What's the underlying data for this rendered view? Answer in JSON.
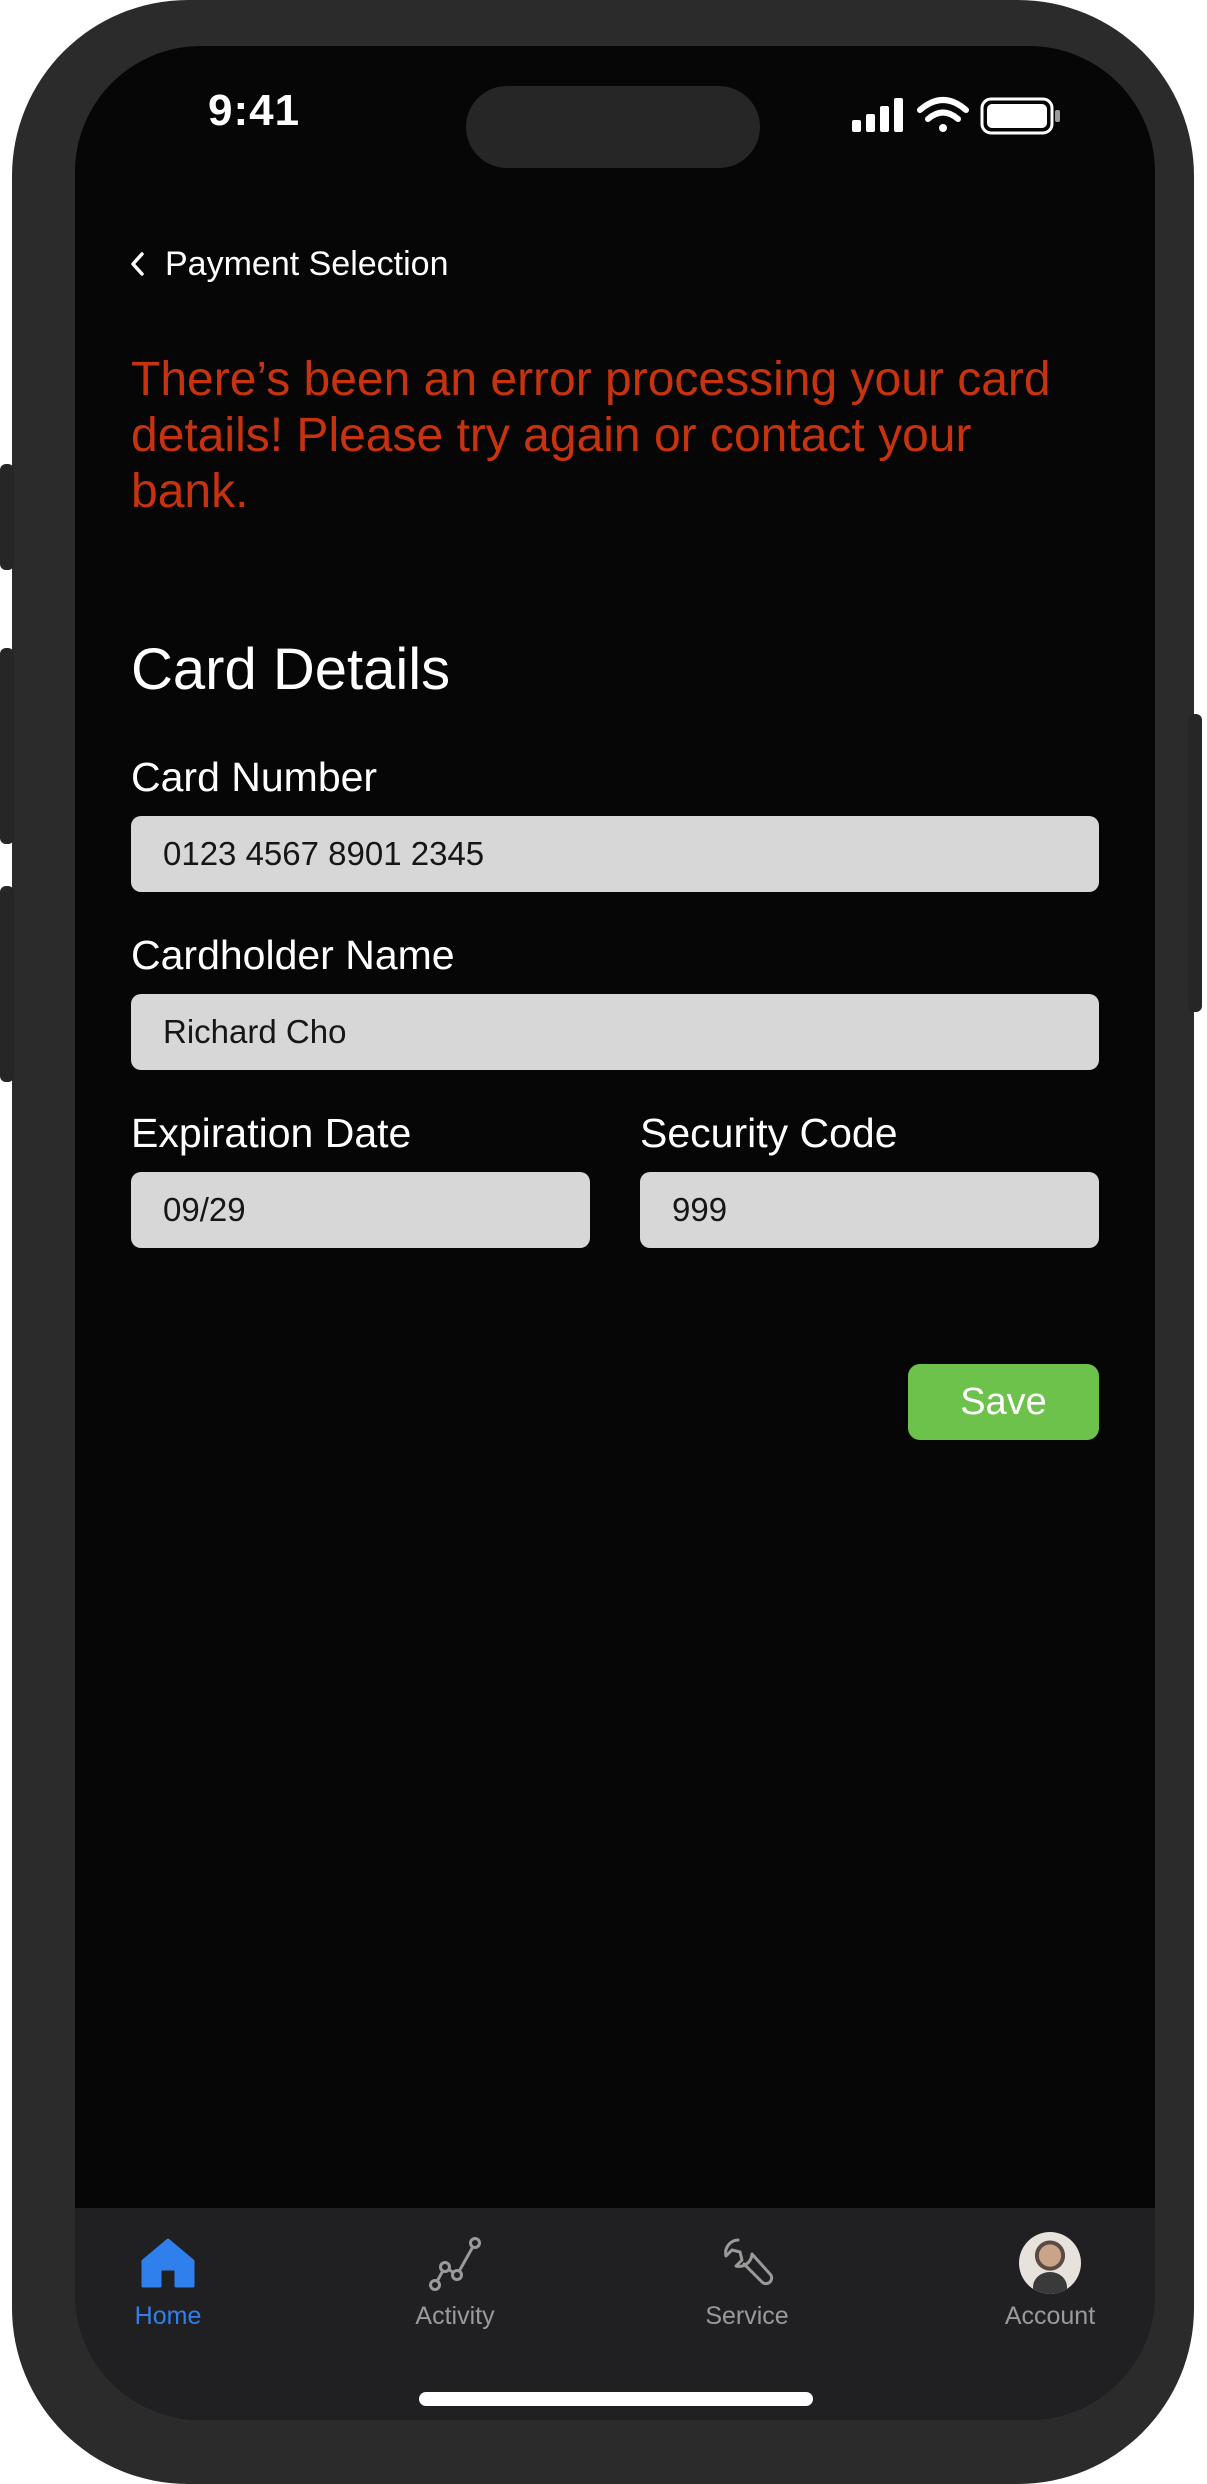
{
  "status_bar": {
    "time": "9:41"
  },
  "nav": {
    "back_label": "Payment Selection"
  },
  "error": {
    "message": "There’s been an error processing your card details! Please try again or contact your bank."
  },
  "form": {
    "title": "Card Details",
    "card_number": {
      "label": "Card Number",
      "value": "0123 4567 8901 2345"
    },
    "cardholder_name": {
      "label": "Cardholder Name",
      "value": "Richard Cho"
    },
    "expiration_date": {
      "label": "Expiration Date",
      "value": "09/29"
    },
    "security_code": {
      "label": "Security Code",
      "value": "999"
    },
    "save_label": "Save"
  },
  "tabbar": {
    "items": [
      {
        "label": "Home",
        "icon": "home-icon",
        "active": true
      },
      {
        "label": "Activity",
        "icon": "activity-icon",
        "active": false
      },
      {
        "label": "Service",
        "icon": "wrench-icon",
        "active": false
      },
      {
        "label": "Account",
        "icon": "avatar",
        "active": false
      }
    ]
  },
  "colors": {
    "error": "#c8330f",
    "accent": "#2f80ed",
    "save": "#6cc24a",
    "input_bg": "#d7d7d7"
  }
}
